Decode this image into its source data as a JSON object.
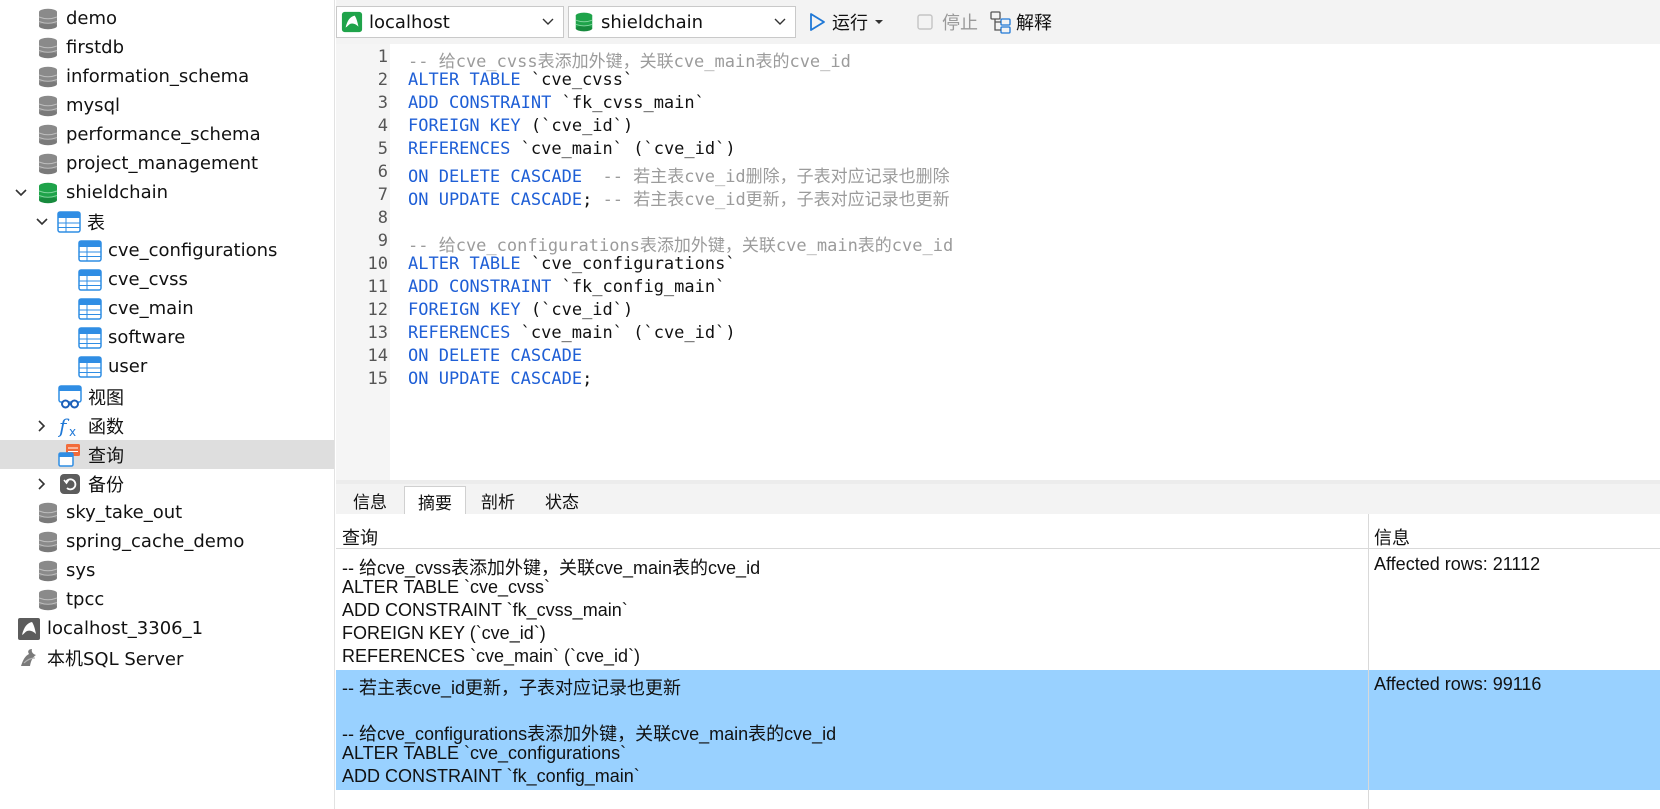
{
  "sidebar": {
    "databases_top": [
      "demo",
      "firstdb",
      "information_schema",
      "mysql",
      "performance_schema",
      "project_management"
    ],
    "active_db": "shieldchain",
    "tables_group": "表",
    "tables": [
      "cve_configurations",
      "cve_cvss",
      "cve_main",
      "software",
      "user"
    ],
    "views": "视图",
    "functions": "函数",
    "queries": "查询",
    "backups": "备份",
    "databases_bottom": [
      "sky_take_out",
      "spring_cache_demo",
      "sys",
      "tpcc"
    ],
    "connections": [
      "localhost_3306_1",
      "本机SQL Server"
    ]
  },
  "toolbar": {
    "connection": "localhost",
    "database": "shieldchain",
    "run_label": "运行",
    "stop_label": "停止",
    "explain_label": "解释"
  },
  "editor": {
    "line_numbers": [
      "1",
      "2",
      "3",
      "4",
      "5",
      "6",
      "7",
      "8",
      "9",
      "10",
      "11",
      "12",
      "13",
      "14",
      "15"
    ],
    "lines": [
      "-- 给cve_cvss表添加外键，关联cve_main表的cve_id",
      "ALTER TABLE `cve_cvss`",
      "ADD CONSTRAINT `fk_cvss_main`",
      "FOREIGN KEY (`cve_id`)",
      "REFERENCES `cve_main` (`cve_id`)",
      "ON DELETE CASCADE  -- 若主表cve_id删除，子表对应记录也删除",
      "ON UPDATE CASCADE; -- 若主表cve_id更新，子表对应记录也更新",
      "",
      "-- 给cve_configurations表添加外键，关联cve_main表的cve_id",
      "ALTER TABLE `cve_configurations`",
      "ADD CONSTRAINT `fk_config_main`",
      "FOREIGN KEY (`cve_id`)",
      "REFERENCES `cve_main` (`cve_id`)",
      "ON DELETE CASCADE",
      "ON UPDATE CASCADE;"
    ]
  },
  "result_tabs": [
    "信息",
    "摘要",
    "剖析",
    "状态"
  ],
  "results": {
    "col_query": "查询",
    "col_info": "信息",
    "rows": [
      {
        "query_lines": [
          "-- 给cve_cvss表添加外键，关联cve_main表的cve_id",
          "ALTER TABLE `cve_cvss`",
          "ADD CONSTRAINT `fk_cvss_main`",
          "FOREIGN KEY (`cve_id`)",
          "REFERENCES `cve_main` (`cve_id`)"
        ],
        "info": "Affected rows: 21112"
      },
      {
        "query_lines": [
          "-- 若主表cve_id更新，子表对应记录也更新",
          "",
          "-- 给cve_configurations表添加外键，关联cve_main表的cve_id",
          "ALTER TABLE `cve_configurations`",
          "ADD CONSTRAINT `fk_config_main`"
        ],
        "info": "Affected rows: 99116"
      }
    ]
  },
  "colors": {
    "keyword": "#1f5fd6",
    "comment": "#9b9b9b",
    "selected_row": "#99d1ff",
    "active_db": "#1fa34a"
  }
}
